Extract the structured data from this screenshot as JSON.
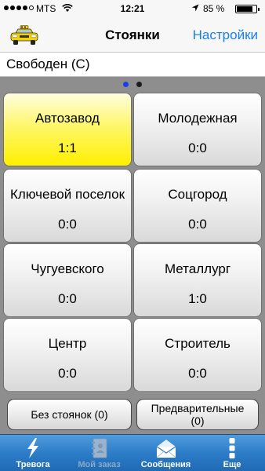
{
  "statusbar": {
    "carrier": "MTS",
    "time": "12:21",
    "battery_percent_text": "85 %",
    "battery_level": 0.85
  },
  "navbar": {
    "title": "Стоянки",
    "settings_label": "Настройки",
    "icon": "taxi-car-icon"
  },
  "driver_status": "Свободен (С)",
  "pager": {
    "pages": 2,
    "current": 1
  },
  "parkings": [
    {
      "name": "Автозавод",
      "count": "1:1",
      "active": true
    },
    {
      "name": "Молодежная",
      "count": "0:0",
      "active": false
    },
    {
      "name": "Ключевой поселок",
      "count": "0:0",
      "active": false
    },
    {
      "name": "Соцгород",
      "count": "0:0",
      "active": false
    },
    {
      "name": "Чугуевского",
      "count": "0:0",
      "active": false
    },
    {
      "name": "Металлург",
      "count": "1:0",
      "active": false
    },
    {
      "name": "Центр",
      "count": "0:0",
      "active": false
    },
    {
      "name": "Строитель",
      "count": "0:0",
      "active": false
    }
  ],
  "buttons": {
    "no_parking": "Без стоянок (0)",
    "preliminary_line1": "Предварительные",
    "preliminary_line2": "(0)"
  },
  "tabs": [
    {
      "label": "Тревога",
      "icon": "lightning-icon",
      "enabled": true
    },
    {
      "label": "Мой заказ",
      "icon": "address-book-icon",
      "enabled": false
    },
    {
      "label": "Сообщения",
      "icon": "envelope-icon",
      "enabled": true
    },
    {
      "label": "Еще",
      "icon": "more-dots-icon",
      "enabled": true
    }
  ],
  "colors": {
    "accent": "#1a7cf5",
    "active_cell": "#fff200",
    "tabbar": "#2c7cc8",
    "pager_active_dot": "#1d3de8"
  }
}
